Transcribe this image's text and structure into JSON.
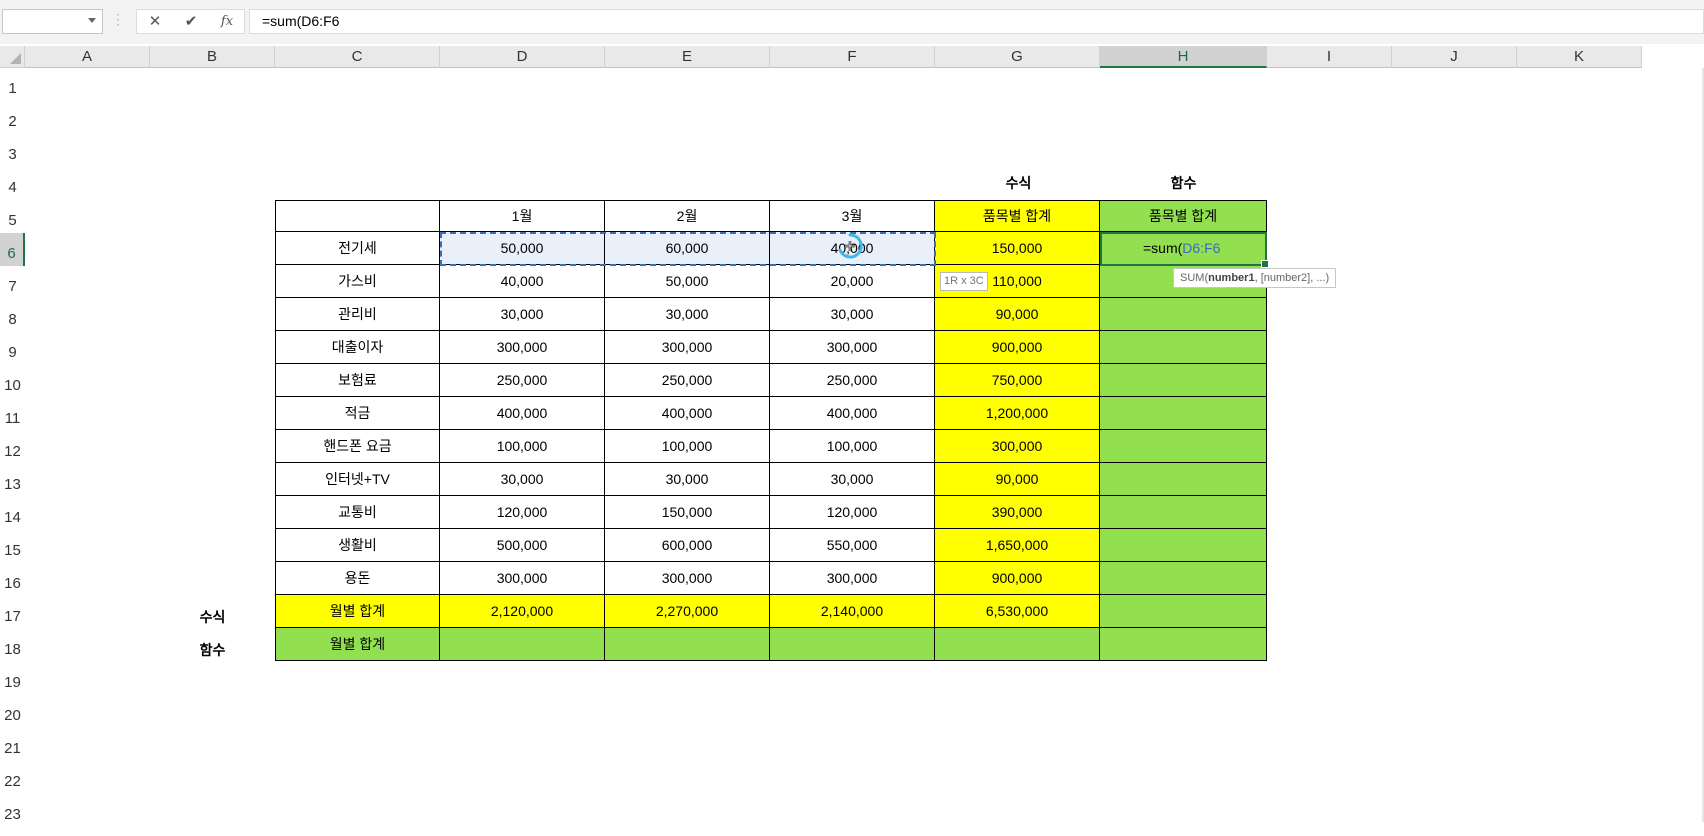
{
  "formula_bar": {
    "name_box": "",
    "cancel_icon": "✕",
    "enter_icon": "✔",
    "fx_label": "fx",
    "formula": "=sum(D6:F6"
  },
  "columns": [
    "A",
    "B",
    "C",
    "D",
    "E",
    "F",
    "G",
    "H",
    "I",
    "J",
    "K"
  ],
  "rows": [
    "1",
    "2",
    "3",
    "4",
    "5",
    "6",
    "7",
    "8",
    "9",
    "10",
    "11",
    "12",
    "13",
    "14",
    "15",
    "16",
    "17",
    "18",
    "19",
    "20",
    "21",
    "22",
    "23"
  ],
  "labels": {
    "g4": "수식",
    "h4": "함수",
    "b17": "수식",
    "b18": "함수"
  },
  "table": {
    "header": [
      "",
      "1월",
      "2월",
      "3월",
      "품목별 합계",
      "품목별 합계"
    ],
    "items": [
      {
        "name": "전기세",
        "jan": "50,000",
        "feb": "60,000",
        "mar": "40,000",
        "total": "150,000"
      },
      {
        "name": "가스비",
        "jan": "40,000",
        "feb": "50,000",
        "mar": "20,000",
        "total": "110,000"
      },
      {
        "name": "관리비",
        "jan": "30,000",
        "feb": "30,000",
        "mar": "30,000",
        "total": "90,000"
      },
      {
        "name": "대출이자",
        "jan": "300,000",
        "feb": "300,000",
        "mar": "300,000",
        "total": "900,000"
      },
      {
        "name": "보험료",
        "jan": "250,000",
        "feb": "250,000",
        "mar": "250,000",
        "total": "750,000"
      },
      {
        "name": "적금",
        "jan": "400,000",
        "feb": "400,000",
        "mar": "400,000",
        "total": "1,200,000"
      },
      {
        "name": "핸드폰 요금",
        "jan": "100,000",
        "feb": "100,000",
        "mar": "100,000",
        "total": "300,000"
      },
      {
        "name": "인터넷+TV",
        "jan": "30,000",
        "feb": "30,000",
        "mar": "30,000",
        "total": "90,000"
      },
      {
        "name": "교통비",
        "jan": "120,000",
        "feb": "150,000",
        "mar": "120,000",
        "total": "390,000"
      },
      {
        "name": "생활비",
        "jan": "500,000",
        "feb": "600,000",
        "mar": "550,000",
        "total": "1,650,000"
      },
      {
        "name": "용돈",
        "jan": "300,000",
        "feb": "300,000",
        "mar": "300,000",
        "total": "900,000"
      }
    ],
    "formula_row": {
      "name": "월별 합계",
      "jan": "2,120,000",
      "feb": "2,270,000",
      "mar": "2,140,000",
      "total": "6,530,000"
    },
    "function_row": {
      "name": "월별 합계"
    }
  },
  "editing": {
    "prefix": "=sum(",
    "ref": "D6:F6"
  },
  "tooltip": {
    "fn": "SUM(",
    "arg1": "number1",
    "rest": ", [number2], ...)"
  },
  "size_tip": "1R x 3C",
  "colors": {
    "yellow": "#ffff00",
    "green": "#92e04f",
    "excel_green": "#217346",
    "ref_blue": "#3a6fb0"
  }
}
